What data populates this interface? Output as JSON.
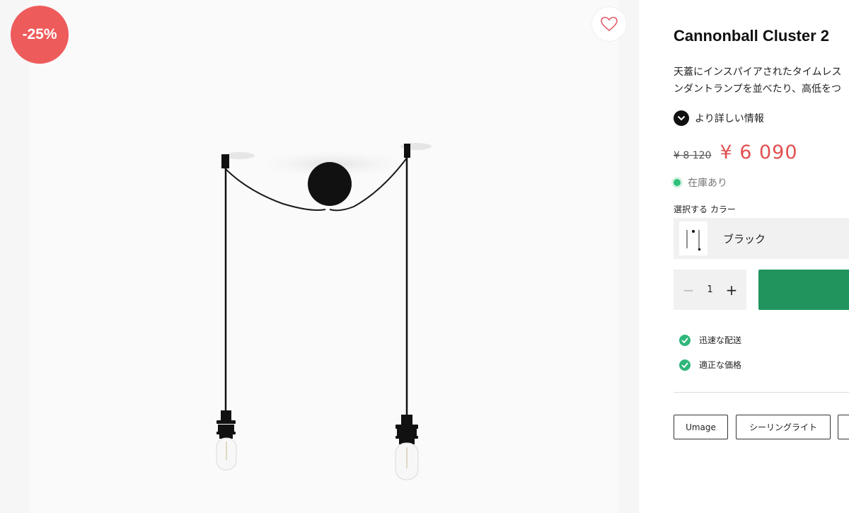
{
  "product": {
    "discount_badge": "-25%",
    "title": "Cannonball Cluster 2",
    "description_line1": "天蓋にインスパイアされたタイムレス",
    "description_line2": "ンダントランプを並べたり、高低をつ",
    "more_info": "より詳しい情報",
    "old_price": "¥ 8 120",
    "new_price": "¥ 6 090",
    "stock_status": "在庫あり",
    "color_label": "選択する カラー",
    "selected_color": "ブラック",
    "quantity": "1",
    "qty_minus": "−",
    "qty_plus": "+"
  },
  "features": [
    "迅速な配送",
    "適正な価格"
  ],
  "tags": [
    "Umage",
    "シーリングライト",
    ""
  ],
  "icons": {
    "wishlist": "heart-icon",
    "more_info": "chevron-down-icon",
    "feature": "check-icon",
    "stock": "status-dot-icon"
  },
  "colors": {
    "badge": "#ee5b5b",
    "sale_price": "#e05050",
    "add_to_cart": "#21945e",
    "stock_dot": "#2fc07a"
  }
}
